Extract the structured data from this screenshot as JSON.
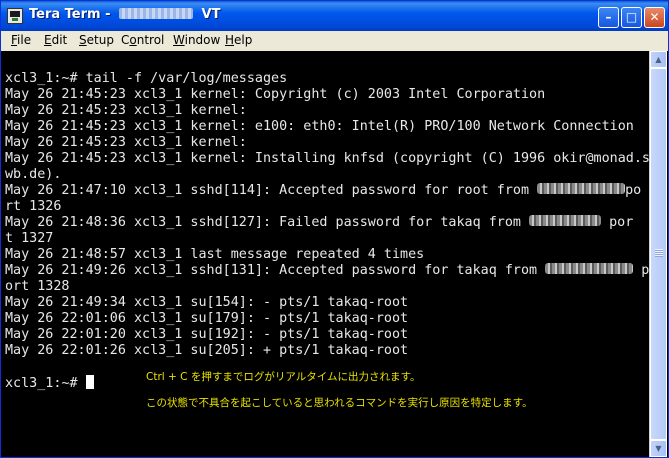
{
  "window": {
    "title_prefix": "Tera Term - ",
    "title_suffix": " VT",
    "title_redacted": true,
    "buttons": {
      "minimize": "–",
      "maximize": "□",
      "close": "✕"
    },
    "icon": "teraterm-app-icon"
  },
  "menubar": {
    "items": [
      {
        "label": "File",
        "accel": "F"
      },
      {
        "label": "Edit",
        "accel": "E"
      },
      {
        "label": "Setup",
        "accel": "S"
      },
      {
        "label": "Control",
        "accel": "O"
      },
      {
        "label": "Window",
        "accel": "W"
      },
      {
        "label": "Help",
        "accel": "H"
      }
    ]
  },
  "terminal": {
    "fg_color": "#e8e8e8",
    "bg_color": "#000000",
    "lines": [
      {
        "text": "xcl3_1:~# tail -f /var/log/messages"
      },
      {
        "text": "May 26 21:45:23 xcl3_1 kernel: Copyright (c) 2003 Intel Corporation"
      },
      {
        "text": "May 26 21:45:23 xcl3_1 kernel:"
      },
      {
        "text": "May 26 21:45:23 xcl3_1 kernel: e100: eth0: Intel(R) PRO/100 Network Connection"
      },
      {
        "text": "May 26 21:45:23 xcl3_1 kernel:"
      },
      {
        "text": "May 26 21:45:23 xcl3_1 kernel: Installing knfsd (copyright (C) 1996 okir@monad.s"
      },
      {
        "text": "wb.de)."
      },
      {
        "text": "May 26 21:47:10 xcl3_1 sshd[114]: Accepted password for root from ",
        "redacted_tail": "po"
      },
      {
        "text": "rt 1326"
      },
      {
        "text": "May 26 21:48:36 xcl3_1 sshd[127]: Failed password for takaq from ",
        "redacted_tail": " por"
      },
      {
        "text": "t 1327"
      },
      {
        "text": "May 26 21:48:57 xcl3_1 last message repeated 4 times"
      },
      {
        "text": "May 26 21:49:26 xcl3_1 sshd[131]: Accepted password for takaq from ",
        "redacted_tail": " p"
      },
      {
        "text": "ort 1328"
      },
      {
        "text": "May 26 21:49:34 xcl3_1 su[154]: - pts/1 takaq-root"
      },
      {
        "text": "May 26 22:01:06 xcl3_1 su[179]: - pts/1 takaq-root"
      },
      {
        "text": "May 26 22:01:20 xcl3_1 su[192]: - pts/1 takaq-root"
      },
      {
        "text": "May 26 22:01:26 xcl3_1 su[205]: + pts/1 takaq-root"
      },
      {
        "text": ""
      },
      {
        "text": "xcl3_1:~# "
      }
    ]
  },
  "annotations": {
    "color": "#e8e000",
    "line1": "Ctrl + C を押すまでログがリアルタイムに出力されます。",
    "line2": "この状態で不具合を起こしていると思われるコマンドを実行し原因を特定します。"
  },
  "scrollbar": {
    "up_icon": "scroll-up-arrow-icon",
    "down_icon": "scroll-down-arrow-icon"
  }
}
